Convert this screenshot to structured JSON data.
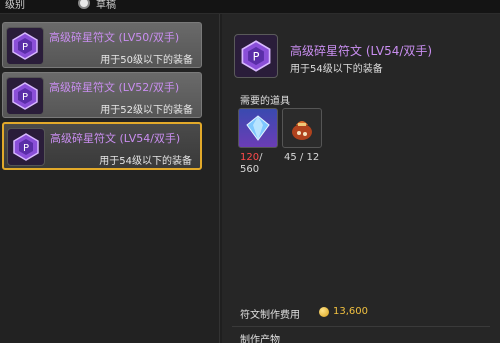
{
  "topbar": {
    "level_label": "级别",
    "draft_label": "草稿"
  },
  "list": {
    "items": [
      {
        "title": "高级碎星符文 (LV50/双手)",
        "desc": "用于50级以下的装备",
        "selected": false
      },
      {
        "title": "高级碎星符文 (LV52/双手)",
        "desc": "用于52级以下的装备",
        "selected": false
      },
      {
        "title": "高级碎星符文 (LV54/双手)",
        "desc": "用于54级以下的装备",
        "selected": true
      }
    ]
  },
  "detail": {
    "title": "高级碎星符文 (LV54/双手)",
    "desc": "用于54级以下的装备",
    "required_label": "需要的道具",
    "materials": [
      {
        "icon": "crystal-icon",
        "have": "120",
        "need": "/560"
      },
      {
        "icon": "bag-icon",
        "have": "45",
        "need": " / 12"
      }
    ],
    "fee_label": "符文制作费用",
    "fee_value": "13,600",
    "product_label": "制作产物"
  },
  "colors": {
    "accent": "#e2a92a",
    "rune_title": "#c98ef0",
    "shortage": "#ff4a4a",
    "gold": "#f0c040"
  }
}
